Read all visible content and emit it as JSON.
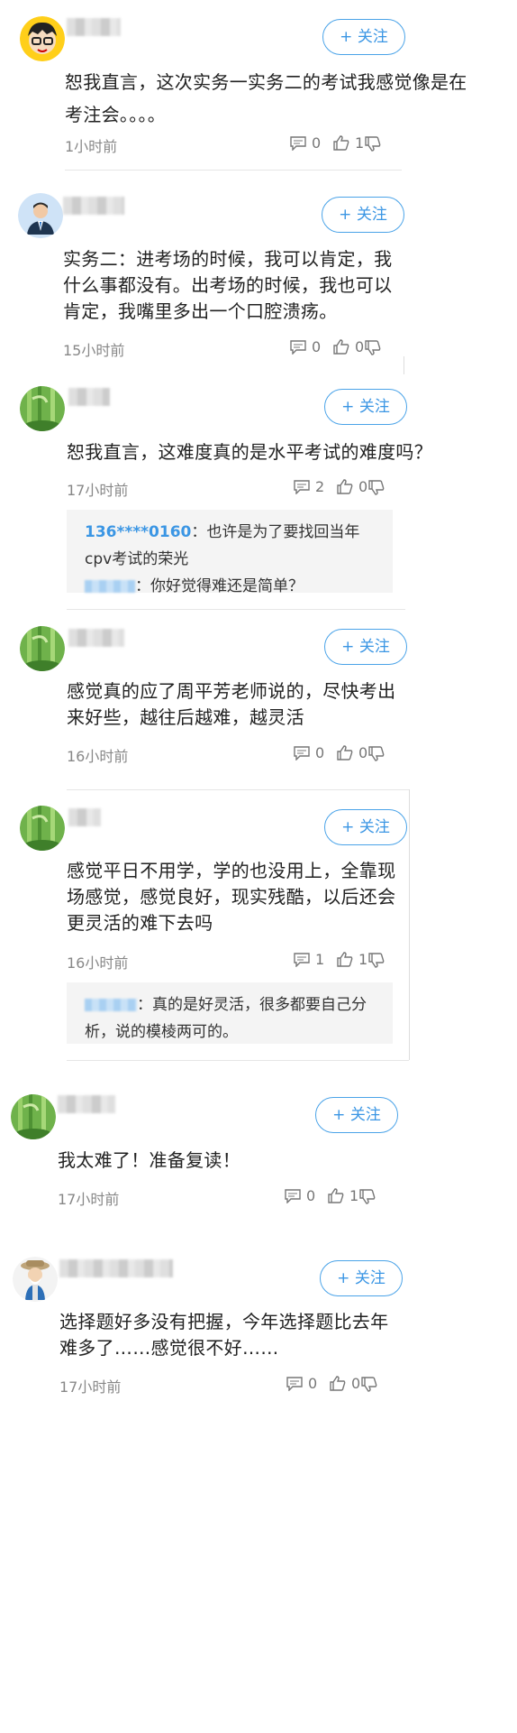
{
  "colors": {
    "accent": "#3b96e4",
    "reply_bg": "#f4f4f4"
  },
  "follow_label": "+ 关注",
  "posts": [
    {
      "content": "恕我直言，这次实务一实务二的考试我感觉像是在考注会。。。。",
      "time": "1小时前",
      "comments": "0",
      "likes": "1",
      "avatar": "cartoon-boy-glasses"
    },
    {
      "content": "实务二：进考场的时候，我可以肯定，我什么事都没有。出考场的时候，我也可以肯定，我嘴里多出一个口腔溃疡。",
      "time": "15小时前",
      "comments": "0",
      "likes": "0",
      "avatar": "businessman"
    },
    {
      "content": "恕我直言，这难度真的是水平考试的难度吗？",
      "time": "17小时前",
      "comments": "2",
      "likes": "0",
      "avatar": "bamboo",
      "replies": [
        {
          "name": "136****0160",
          "text": "：也许是为了要找回当年cpv考试的荣光"
        },
        {
          "name": "",
          "text": "：你好觉得难还是简单？"
        }
      ]
    },
    {
      "content": "感觉真的应了周平芳老师说的，尽快考出来好些，越往后越难，越灵活",
      "time": "16小时前",
      "comments": "0",
      "likes": "0",
      "avatar": "bamboo"
    },
    {
      "content": "感觉平日不用学，学的也没用上，全靠现场感觉，感觉良好，现实残酷，以后还会更灵活的难下去吗",
      "time": "16小时前",
      "comments": "1",
      "likes": "1",
      "avatar": "bamboo",
      "replies": [
        {
          "name": "",
          "text": "：真的是好灵活，很多都要自己分析，说的模棱两可的。"
        }
      ]
    },
    {
      "content": "我太难了！准备复读！",
      "time": "17小时前",
      "comments": "0",
      "likes": "1",
      "avatar": "bamboo"
    },
    {
      "content": "选择题好多没有把握，今年选择题比去年难多了……感觉很不好……",
      "time": "17小时前",
      "comments": "0",
      "likes": "0",
      "avatar": "cartoon-oldman"
    }
  ]
}
